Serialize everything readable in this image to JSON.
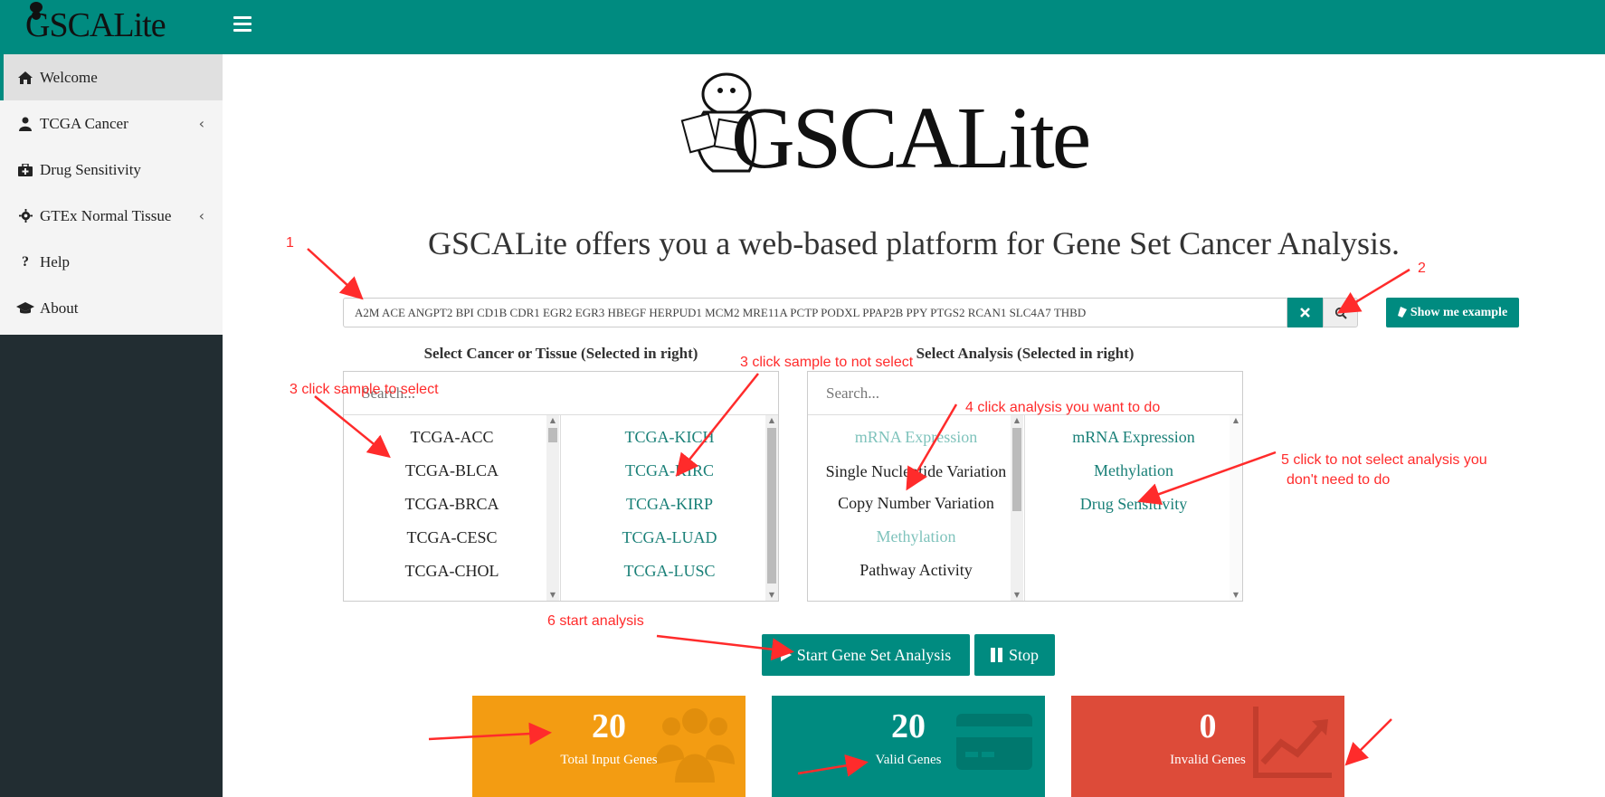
{
  "header": {
    "brand": "GSCALite",
    "menu_icon": "hamburger-icon",
    "color": "#008b80"
  },
  "sidebar": {
    "items": [
      {
        "label": "Welcome",
        "icon": "home-icon"
      },
      {
        "label": "TCGA Cancer",
        "icon": "user-md-icon"
      },
      {
        "label": "Drug Sensitivity",
        "icon": "medkit-icon"
      },
      {
        "label": "GTEx Normal Tissue",
        "icon": "gear-icon"
      },
      {
        "label": "Help",
        "icon": "question-icon"
      },
      {
        "label": "About",
        "icon": "graduation-cap-icon"
      }
    ]
  },
  "main": {
    "logo_text": "GSCALite",
    "headline": "GSCALite offers you a web-based platform for Gene Set Cancer Analysis.",
    "gene_input_value": "A2M ACE ANGPT2 BPI CD1B CDR1 EGR2 EGR3 HBEGF HERPUD1 MCM2 MRE11A PCTP PODXL PPAP2B PPY PTGS2 RCAN1 SLC4A7 THBD",
    "show_example_label": "Show me example",
    "cancer_select": {
      "title": "Select Cancer or Tissue (Selected in right)",
      "search_placeholder": "Search...",
      "available": [
        "TCGA-ACC",
        "TCGA-BLCA",
        "TCGA-BRCA",
        "TCGA-CESC",
        "TCGA-CHOL"
      ],
      "selected": [
        "TCGA-KICH",
        "TCGA-KIRC",
        "TCGA-KIRP",
        "TCGA-LUAD",
        "TCGA-LUSC"
      ]
    },
    "analysis_select": {
      "title": "Select Analysis (Selected in right)",
      "search_placeholder": "Search...",
      "available": [
        "mRNA Expression",
        "Single Nucleotide Variation",
        "Copy Number Variation",
        "Methylation",
        "Pathway Activity"
      ],
      "selected": [
        "mRNA Expression",
        "Methylation",
        "Drug Sensitivity"
      ]
    },
    "start_label": "Start Gene Set Analysis",
    "stop_label": "Stop"
  },
  "stats": [
    {
      "value": "20",
      "label": "Total Input Genes",
      "color": "#f39c12",
      "icon": "users-icon"
    },
    {
      "value": "20",
      "label": "Valid Genes",
      "color": "#008b80",
      "icon": "credit-card-icon"
    },
    {
      "value": "0",
      "label": "Invalid Genes",
      "color": "#dd4b39",
      "icon": "line-chart-icon"
    }
  ],
  "annotations": {
    "a1": "1",
    "a2": "2",
    "a3_select": "3 click sample to select",
    "a3_deselect": "3 click sample to not select",
    "a4": "4 click analysis you want to do",
    "a5_line1": "5 click to not select analysis you",
    "a5_line2": "don't need to do",
    "a6": "6 start analysis",
    "color": "#ff2b2b"
  }
}
